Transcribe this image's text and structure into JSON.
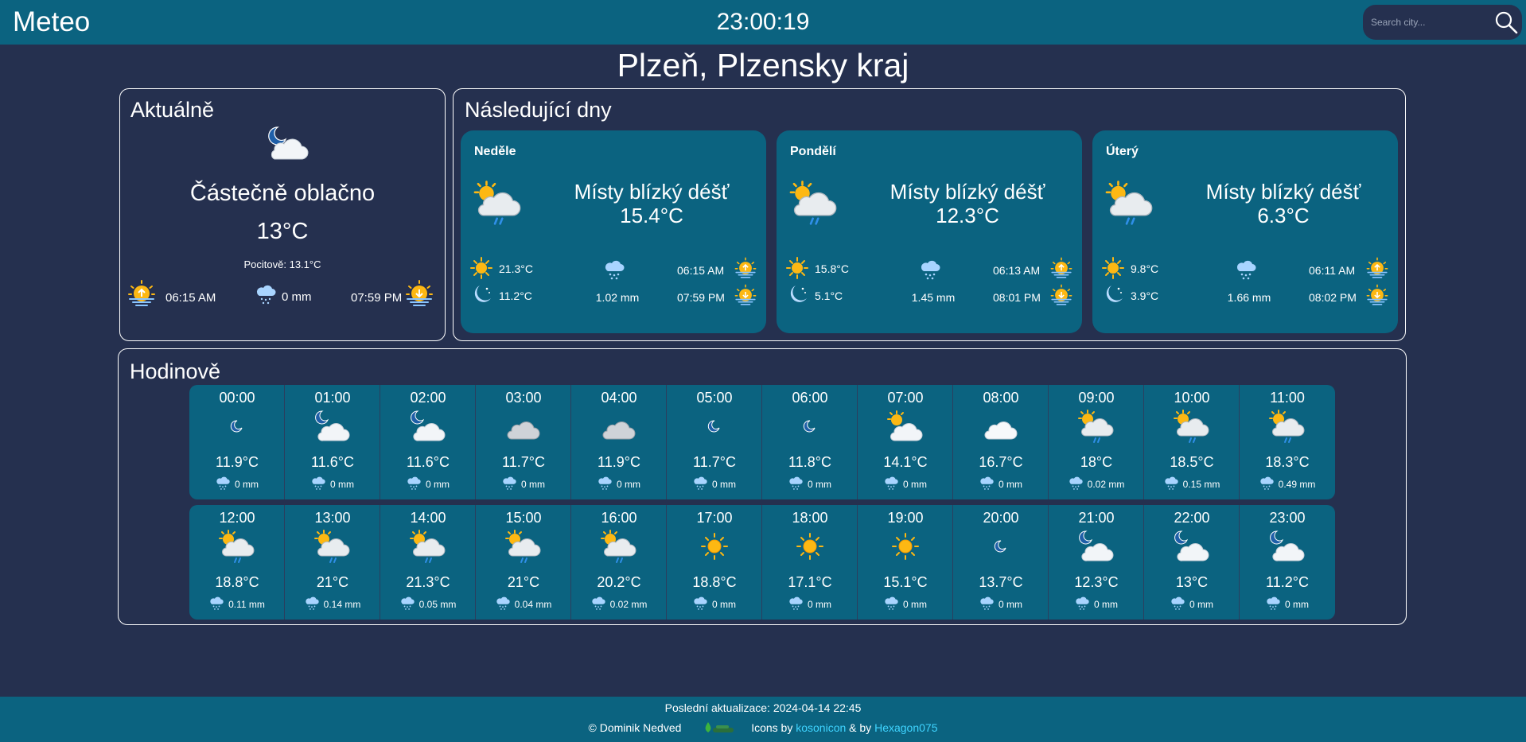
{
  "header": {
    "brand": "Meteo",
    "clock": "23:00:19",
    "search_placeholder": "Search city..."
  },
  "city": "Plzeň, Plzensky kraj",
  "current": {
    "title": "Aktuálně",
    "icon": "night-partly-cloudy-icon",
    "condition": "Částečně oblačno",
    "temp": "13°C",
    "feels_like": "Pocitově: 13.1°C",
    "sunrise": "06:15 AM",
    "precip": "0 mm",
    "sunset": "07:59 PM"
  },
  "forecast": {
    "title": "Následující dny",
    "days": [
      {
        "name": "Neděle",
        "icon": "sun-cloud-rain-icon",
        "condition": "Místy blízký déšť",
        "temp": "15.4°C",
        "max": "21.3°C",
        "min": "11.2°C",
        "precip": "1.02 mm",
        "sunrise": "06:15 AM",
        "sunset": "07:59 PM"
      },
      {
        "name": "Pondělí",
        "icon": "sun-cloud-rain-icon",
        "condition": "Místy blízký déšť",
        "temp": "12.3°C",
        "max": "15.8°C",
        "min": "5.1°C",
        "precip": "1.45 mm",
        "sunrise": "06:13 AM",
        "sunset": "08:01 PM"
      },
      {
        "name": "Úterý",
        "icon": "sun-cloud-rain-icon",
        "condition": "Místy blízký déšť",
        "temp": "6.3°C",
        "max": "9.8°C",
        "min": "3.9°C",
        "precip": "1.66 mm",
        "sunrise": "06:11 AM",
        "sunset": "08:02 PM"
      }
    ]
  },
  "hourly": {
    "title": "Hodinově",
    "rows": [
      [
        {
          "time": "00:00",
          "icon": "moon",
          "temp": "11.9°C",
          "rain": "0 mm"
        },
        {
          "time": "01:00",
          "icon": "moon-cloud",
          "temp": "11.6°C",
          "rain": "0 mm"
        },
        {
          "time": "02:00",
          "icon": "moon-cloud",
          "temp": "11.6°C",
          "rain": "0 mm"
        },
        {
          "time": "03:00",
          "icon": "cloud-gray",
          "temp": "11.7°C",
          "rain": "0 mm"
        },
        {
          "time": "04:00",
          "icon": "cloud-gray",
          "temp": "11.9°C",
          "rain": "0 mm"
        },
        {
          "time": "05:00",
          "icon": "moon",
          "temp": "11.7°C",
          "rain": "0 mm"
        },
        {
          "time": "06:00",
          "icon": "moon",
          "temp": "11.8°C",
          "rain": "0 mm"
        },
        {
          "time": "07:00",
          "icon": "sun-cloud",
          "temp": "14.1°C",
          "rain": "0 mm"
        },
        {
          "time": "08:00",
          "icon": "cloud-white",
          "temp": "16.7°C",
          "rain": "0 mm"
        },
        {
          "time": "09:00",
          "icon": "sun-cloud-rain",
          "temp": "18°C",
          "rain": "0.02 mm"
        },
        {
          "time": "10:00",
          "icon": "sun-cloud-rain",
          "temp": "18.5°C",
          "rain": "0.15 mm"
        },
        {
          "time": "11:00",
          "icon": "sun-cloud-rain",
          "temp": "18.3°C",
          "rain": "0.49 mm"
        }
      ],
      [
        {
          "time": "12:00",
          "icon": "sun-cloud-rain",
          "temp": "18.8°C",
          "rain": "0.11 mm"
        },
        {
          "time": "13:00",
          "icon": "sun-cloud-rain",
          "temp": "21°C",
          "rain": "0.14 mm"
        },
        {
          "time": "14:00",
          "icon": "sun-cloud-rain",
          "temp": "21.3°C",
          "rain": "0.05 mm"
        },
        {
          "time": "15:00",
          "icon": "sun-cloud-rain",
          "temp": "21°C",
          "rain": "0.04 mm"
        },
        {
          "time": "16:00",
          "icon": "sun-cloud-rain",
          "temp": "20.2°C",
          "rain": "0.02 mm"
        },
        {
          "time": "17:00",
          "icon": "sun",
          "temp": "18.8°C",
          "rain": "0 mm"
        },
        {
          "time": "18:00",
          "icon": "sun",
          "temp": "17.1°C",
          "rain": "0 mm"
        },
        {
          "time": "19:00",
          "icon": "sun",
          "temp": "15.1°C",
          "rain": "0 mm"
        },
        {
          "time": "20:00",
          "icon": "moon",
          "temp": "13.7°C",
          "rain": "0 mm"
        },
        {
          "time": "21:00",
          "icon": "moon-cloud",
          "temp": "12.3°C",
          "rain": "0 mm"
        },
        {
          "time": "22:00",
          "icon": "moon-cloud",
          "temp": "13°C",
          "rain": "0 mm"
        },
        {
          "time": "23:00",
          "icon": "moon-cloud",
          "temp": "11.2°C",
          "rain": "0 mm"
        }
      ]
    ]
  },
  "footer": {
    "last_update": "Poslední aktualizace: 2024-04-14 22:45",
    "author": "© Dominik Nedved",
    "icons_by": "Icons by",
    "link1": "kosonicon",
    "and_by": "& by",
    "link2": "Hexagon075"
  },
  "colors": {
    "background": "#25304f",
    "accent": "#0b6380",
    "link": "#3fd4ff",
    "sun": "#fdb813"
  }
}
